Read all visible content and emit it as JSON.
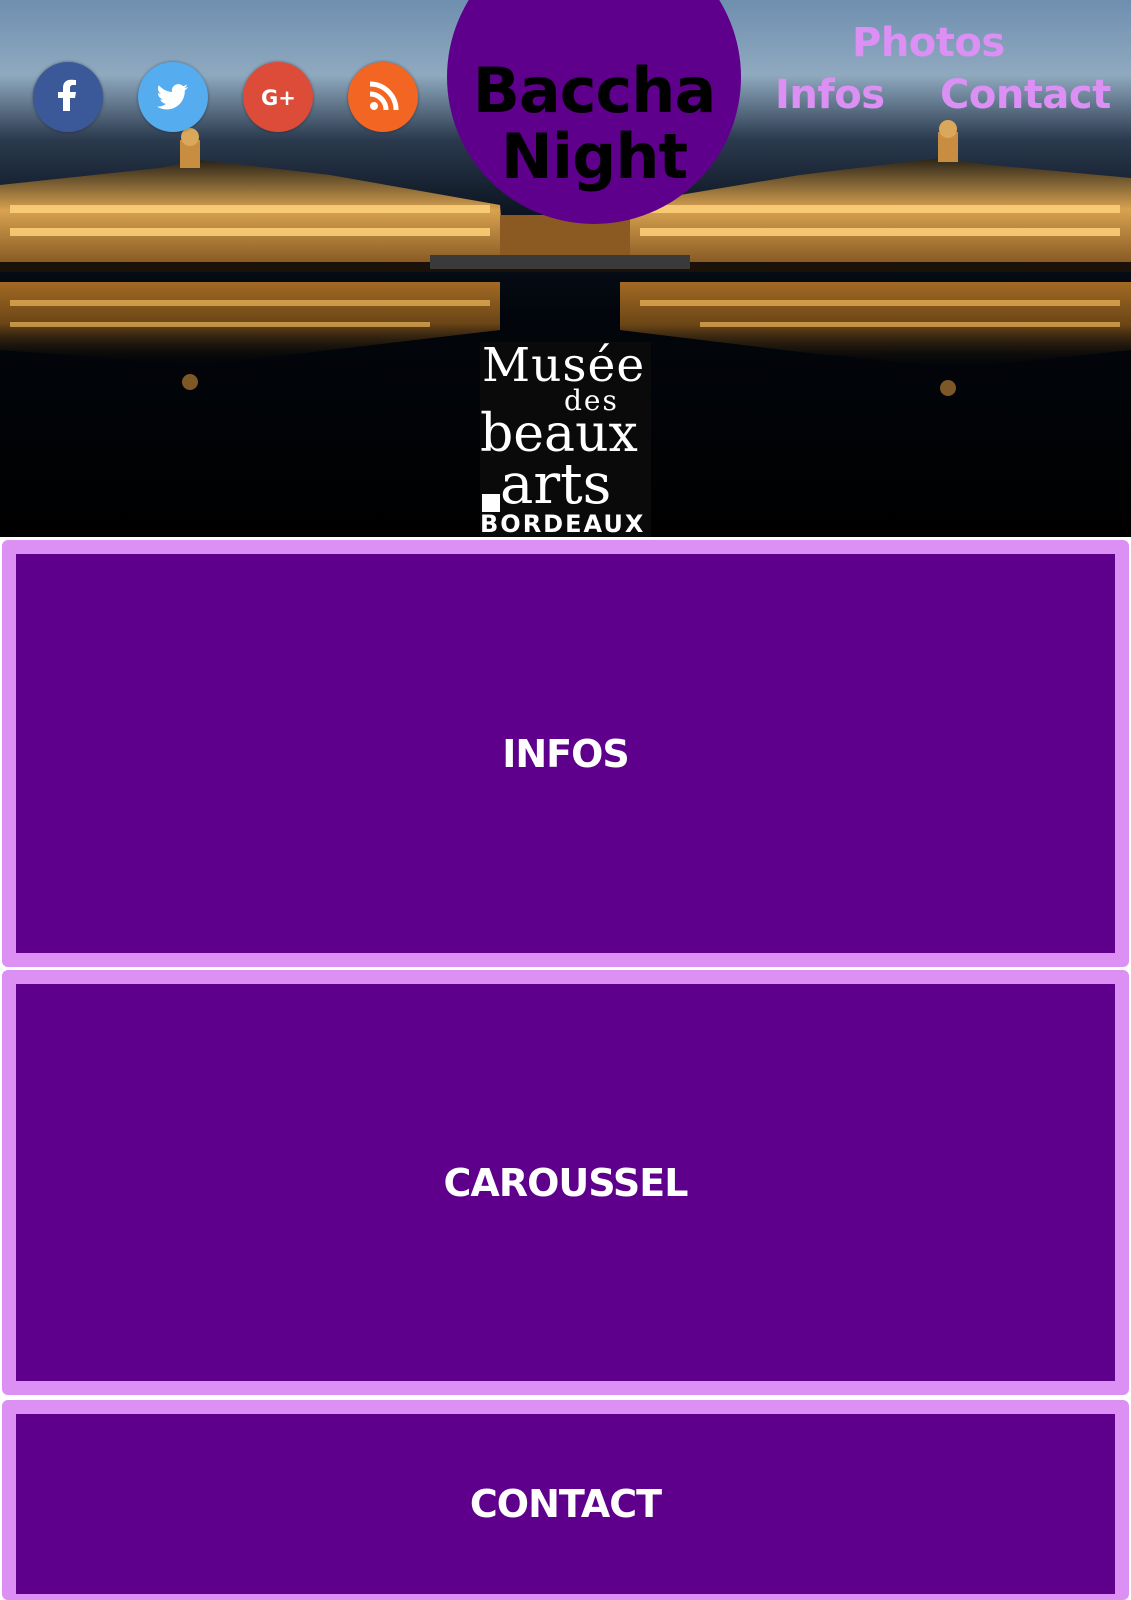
{
  "brand": {
    "line1": "Baccha",
    "line2": "Night"
  },
  "nav": {
    "photos": "Photos",
    "infos": "Infos",
    "contact": "Contact"
  },
  "social": [
    {
      "name": "facebook-icon",
      "color": "#3b5998"
    },
    {
      "name": "twitter-icon",
      "color": "#55acee"
    },
    {
      "name": "google-plus-icon",
      "color": "#dd4b39"
    },
    {
      "name": "rss-icon",
      "color": "#f26522"
    }
  ],
  "museum_logo": {
    "line1": "Musée",
    "line2": "des",
    "line3": "beaux",
    "line4": "arts",
    "line5": "BORDEAUX"
  },
  "sections": {
    "infos": "INFOS",
    "carousel": "CAROUSSEL",
    "contact": "CONTACT"
  },
  "colors": {
    "primary_purple": "#5e008c",
    "light_purple": "#dc90f4",
    "nav_text": "#dc90f4"
  }
}
